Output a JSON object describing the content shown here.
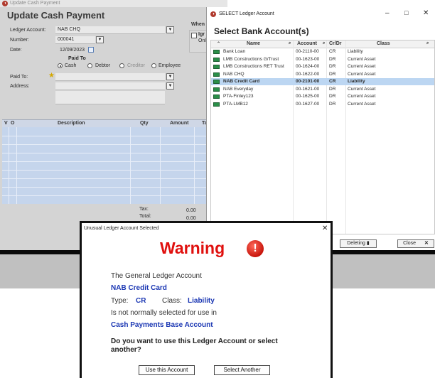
{
  "cash_payment": {
    "window_title": "Update Cash Payment",
    "heading": "Update Cash Payment",
    "ledger_account_label": "Ledger Account:",
    "ledger_account_value": "NAB CHQ",
    "number_label": "Number:",
    "number_value": "000041",
    "date_label": "Date:",
    "date_value": "12/09/2023",
    "paid_to_group_label": "Paid To",
    "radio_cash": "Cash",
    "radio_debtor": "Debtor",
    "radio_creditor": "Creditor",
    "radio_employee": "Employee",
    "paid_to_label": "Paid To:",
    "address_label": "Address:",
    "when_label": "When",
    "when_check_label": "Igr",
    "when_sub_label": "Onl",
    "grid_headers": {
      "v": "V",
      "o": "O",
      "description": "Description",
      "qty": "Qty",
      "amount": "Amount",
      "t": "Ta"
    },
    "tax_label": "Tax:",
    "tax_value": "0.00",
    "total_label": "Total:",
    "total_value": "0.00"
  },
  "select_ledger": {
    "window_title": "SELECT Ledger Account",
    "heading": "Select Bank Account(s)",
    "columns": {
      "name": "Name",
      "account": "Account",
      "crdr": "Cr/Dr",
      "class": "Class"
    },
    "rows": [
      {
        "name": "Bank Loan",
        "account": "00-2110-00",
        "crdr": "CR",
        "class": "Liability"
      },
      {
        "name": "LMB Constructions G/Trust",
        "account": "00-1623-00",
        "crdr": "DR",
        "class": "Current Asset"
      },
      {
        "name": "LMB Constructions RET Trust",
        "account": "00-1624-00",
        "crdr": "DR",
        "class": "Current Asset"
      },
      {
        "name": "NAB CHQ",
        "account": "00-1622-00",
        "crdr": "DR",
        "class": "Current Asset"
      },
      {
        "name": "NAB Credit Card",
        "account": "00-2101-00",
        "crdr": "CR",
        "class": "Liability"
      },
      {
        "name": "NAB Everyday",
        "account": "00-1621-00",
        "crdr": "DR",
        "class": "Current Asset"
      },
      {
        "name": "PTA-Finley123",
        "account": "00-1625-00",
        "crdr": "DR",
        "class": "Current Asset"
      },
      {
        "name": "PTA-LMB12",
        "account": "00-1627-00",
        "crdr": "DR",
        "class": "Current Asset"
      }
    ],
    "selected_index": 4,
    "deleting_button": "Deleting",
    "close_button": "Close"
  },
  "warning_dialog": {
    "window_title": "Unusual Ledger Account Selected",
    "heading": "Warning",
    "line1": "The General Ledger Account",
    "account_name": "NAB Credit Card",
    "type_label": "Type:",
    "type_value": "CR",
    "class_label": "Class:",
    "class_value": "Liability",
    "line3": "Is not normally selected for use in",
    "context": "Cash Payments Base Account",
    "question": "Do you want to use this Ledger Account or select another?",
    "use_button": "Use this Account",
    "select_button": "Select Another"
  },
  "colors": {
    "warning_red": "#e0100e",
    "link_blue": "#1b37b3",
    "selected_row": "#bcd6f2"
  }
}
